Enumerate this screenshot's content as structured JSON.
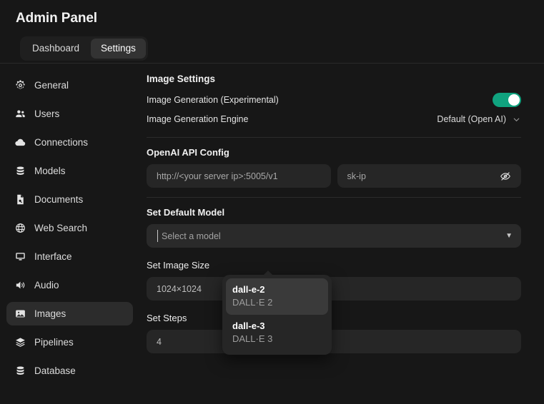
{
  "header": {
    "title": "Admin Panel",
    "tabs": [
      {
        "label": "Dashboard",
        "active": false
      },
      {
        "label": "Settings",
        "active": true
      }
    ]
  },
  "sidebar": {
    "items": [
      {
        "label": "General",
        "icon": "gear-icon",
        "active": false
      },
      {
        "label": "Users",
        "icon": "users-icon",
        "active": false
      },
      {
        "label": "Connections",
        "icon": "cloud-icon",
        "active": false
      },
      {
        "label": "Models",
        "icon": "database-icon",
        "active": false
      },
      {
        "label": "Documents",
        "icon": "document-icon",
        "active": false
      },
      {
        "label": "Web Search",
        "icon": "globe-icon",
        "active": false
      },
      {
        "label": "Interface",
        "icon": "monitor-icon",
        "active": false
      },
      {
        "label": "Audio",
        "icon": "speaker-icon",
        "active": false
      },
      {
        "label": "Images",
        "icon": "image-icon",
        "active": true
      },
      {
        "label": "Pipelines",
        "icon": "layers-icon",
        "active": false
      },
      {
        "label": "Database",
        "icon": "database-icon",
        "active": false
      }
    ]
  },
  "main": {
    "image_settings": {
      "section_title": "Image Settings",
      "generation_label": "Image Generation (Experimental)",
      "generation_enabled": true,
      "engine_label": "Image Generation Engine",
      "engine_value": "Default (Open AI)"
    },
    "api_config": {
      "title": "OpenAI API Config",
      "url_value": "http://<your server ip>:5005/v1",
      "key_value": "sk-ip",
      "key_visibility_icon": "eye-off-icon"
    },
    "default_model": {
      "title": "Set Default Model",
      "placeholder": "Select a model",
      "arrow_icon": "triangle-down-icon",
      "options": [
        {
          "name": "dall-e-2",
          "sub": "DALL·E 2",
          "selected": true
        },
        {
          "name": "dall-e-3",
          "sub": "DALL·E 3",
          "selected": false
        }
      ]
    },
    "image_size": {
      "title": "Set Image Size",
      "value": "1024×1024"
    },
    "steps": {
      "title": "Set Steps",
      "value": "4"
    }
  },
  "colors": {
    "background": "#171717",
    "accent_green": "#10a37f",
    "field": "#262626",
    "active_item": "#2c2c2c"
  }
}
